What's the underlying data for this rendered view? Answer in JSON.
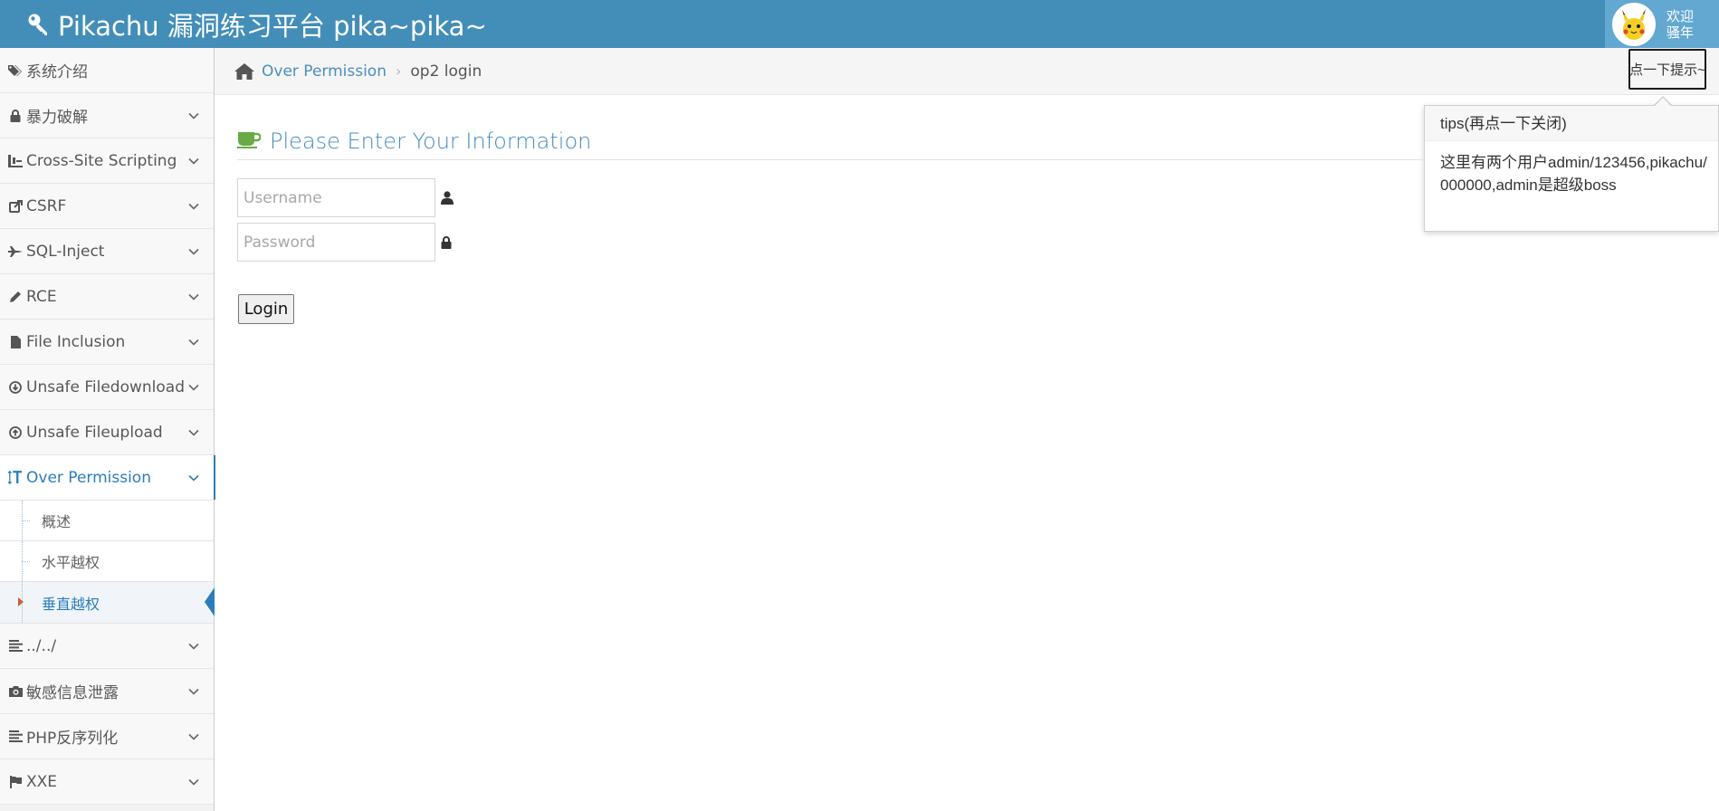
{
  "navbar": {
    "brand": "Pikachu 漏洞练习平台 pika~pika~",
    "welcome_line1": "欢迎",
    "welcome_line2": "骚年"
  },
  "sidebar": {
    "items": [
      {
        "label": "系统介绍",
        "icon": "tags-icon"
      },
      {
        "label": "暴力破解",
        "icon": "lock-icon"
      },
      {
        "label": "Cross-Site Scripting",
        "icon": "sitemap-icon"
      },
      {
        "label": "CSRF",
        "icon": "share-icon"
      },
      {
        "label": "SQL-Inject",
        "icon": "fighter-jet-icon"
      },
      {
        "label": "RCE",
        "icon": "pencil-icon"
      },
      {
        "label": "File Inclusion",
        "icon": "file-icon"
      },
      {
        "label": "Unsafe Filedownload",
        "icon": "download-circle-icon"
      },
      {
        "label": "Unsafe Fileupload",
        "icon": "upload-circle-icon"
      },
      {
        "label": "Over Permission",
        "icon": "text-height-icon"
      },
      {
        "label": "../../",
        "icon": "align-left-icon"
      },
      {
        "label": "敏感信息泄露",
        "icon": "camera-icon"
      },
      {
        "label": "PHP反序列化",
        "icon": "align-left-icon"
      },
      {
        "label": "XXE",
        "icon": "flag-icon"
      }
    ],
    "submenu": [
      "概述",
      "水平越权",
      "垂直越权"
    ]
  },
  "breadcrumb": {
    "link": "Over Permission",
    "current": "op2 login",
    "hint_button": "点一下提示~"
  },
  "popover": {
    "title": "tips(再点一下关闭)",
    "content": "这里有两个用户admin/123456,pikachu/000000,admin是超级boss"
  },
  "main": {
    "header": "Please Enter Your Information",
    "username_placeholder": "Username",
    "password_placeholder": "Password",
    "login_label": "Login"
  },
  "colors": {
    "navbar": "#438eb9",
    "accent": "#2b7dbc",
    "header_icon": "#69aa46"
  }
}
